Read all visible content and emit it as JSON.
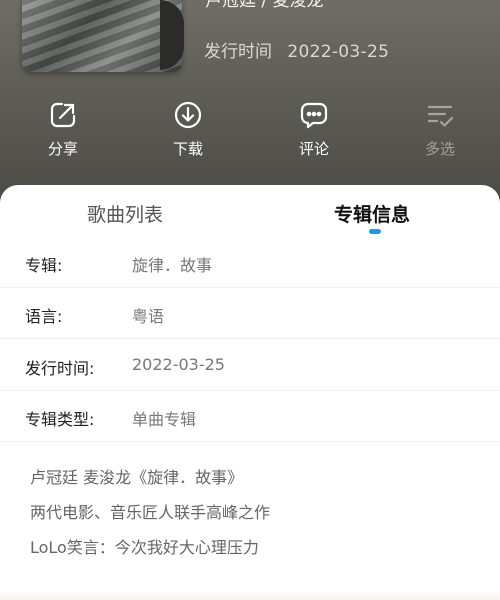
{
  "header": {
    "artist_line": "卢冠廷 / 麦浚龙",
    "release_label": "发行时间",
    "release_date": "2022-03-25"
  },
  "actions": [
    {
      "label": "分享",
      "icon": "share-icon",
      "enabled": true
    },
    {
      "label": "下载",
      "icon": "download-icon",
      "enabled": true
    },
    {
      "label": "评论",
      "icon": "comment-icon",
      "enabled": true
    },
    {
      "label": "多选",
      "icon": "multi-select-icon",
      "enabled": false
    }
  ],
  "tabs": [
    {
      "label": "歌曲列表",
      "active": false
    },
    {
      "label": "专辑信息",
      "active": true
    }
  ],
  "info": [
    {
      "key": "专辑:",
      "value": "旋律．故事"
    },
    {
      "key": "语言:",
      "value": "粤语"
    },
    {
      "key": "发行时间:",
      "value": "2022-03-25"
    },
    {
      "key": "专辑类型:",
      "value": "单曲专辑"
    }
  ],
  "description": [
    "卢冠廷 麦浚龙《旋律．故事》",
    "两代电影、音乐匠人联手高峰之作",
    "LoLo笑言：今次我好大心理压力"
  ],
  "colors": {
    "accent": "#1a9be6",
    "header_bg": "#5d5c55"
  }
}
